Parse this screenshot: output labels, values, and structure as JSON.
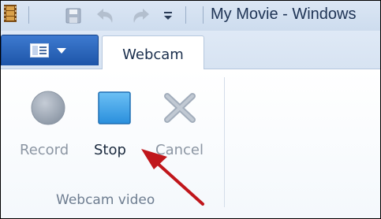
{
  "window": {
    "title": "My Movie - Windows"
  },
  "quick_access": {
    "icons": [
      "film-icon",
      "save-icon",
      "undo-icon",
      "redo-icon",
      "customize-dropdown-icon"
    ]
  },
  "ribbon": {
    "active_tab": "Webcam",
    "group": {
      "label": "Webcam video",
      "buttons": [
        {
          "label": "Record",
          "icon": "record-icon",
          "enabled": false
        },
        {
          "label": "Stop",
          "icon": "stop-icon",
          "enabled": true
        },
        {
          "label": "Cancel",
          "icon": "cancel-icon",
          "enabled": false
        }
      ]
    }
  },
  "colors": {
    "accent_blue": "#2d68c0",
    "stop_icon": "#33a0e8",
    "annotation_arrow": "#c0161b"
  }
}
